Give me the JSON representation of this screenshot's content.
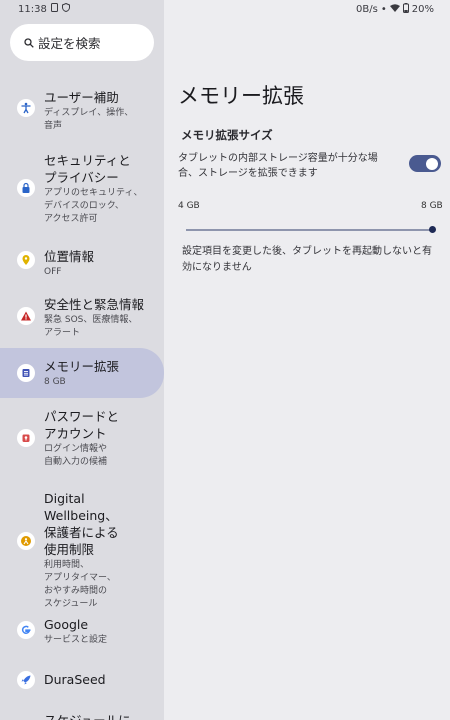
{
  "status_bar": {
    "time": "11:38",
    "network_speed": "0B/s",
    "battery": "20%"
  },
  "search": {
    "placeholder": "設定を検索"
  },
  "sidebar": {
    "items": [
      {
        "title": "ユーザー補助",
        "subtitle": "ディスプレイ、操作、\n音声",
        "icon": "accessibility-icon",
        "icon_color": "#2a64c8"
      },
      {
        "title": "セキュリティと\nプライバシー",
        "subtitle": "アプリのセキュリティ、\nデバイスのロック、\nアクセス許可",
        "icon": "lock-icon",
        "icon_color": "#2a64c8"
      },
      {
        "title": "位置情報",
        "subtitle": "OFF",
        "icon": "location-pin-icon",
        "icon_color": "#e0b300"
      },
      {
        "title": "安全性と緊急情報",
        "subtitle": "緊急 SOS、医療情報、\nアラート",
        "icon": "emergency-icon",
        "icon_color": "#c62828"
      },
      {
        "title": "メモリー拡張",
        "subtitle": "8 GB",
        "icon": "memory-icon",
        "icon_color": "#3f51b5",
        "active": true
      },
      {
        "title": "パスワードと\nアカウント",
        "subtitle": "ログイン情報や\n自動入力の候補",
        "icon": "key-icon",
        "icon_color": "#d84b4b"
      },
      {
        "title": "Digital Wellbeing、\n保護者による\n使用制限",
        "subtitle": "利用時間、\nアプリタイマー、\nおやすみ時間の\nスケジュール",
        "icon": "wellbeing-icon",
        "icon_color": "#e09a00"
      },
      {
        "title": "Google",
        "subtitle": "サービスと設定",
        "icon": "google-icon",
        "icon_color": "#4285f4"
      },
      {
        "title": "DuraSeed",
        "subtitle": "",
        "icon": "rocket-icon",
        "icon_color": "#3a6fe0"
      },
      {
        "title": "スケジュールに",
        "subtitle": "",
        "icon": "schedule-icon",
        "icon_color": "#555"
      }
    ]
  },
  "main": {
    "title": "メモリー拡張",
    "section_title": "メモリ拡張サイズ",
    "toggle_description": "タブレットの内部ストレージ容量が十分な場合、ストレージを拡張できます",
    "toggle_on": true,
    "slider": {
      "min_label": "4 GB",
      "max_label": "8 GB",
      "value_gb": 8,
      "min_gb": 4,
      "max_gb": 8
    },
    "note": "設定項目を変更した後、タブレットを再起動しないと有効になりません"
  },
  "colors": {
    "accent": "#4a5a90",
    "active_item_bg": "#c2c5dd",
    "sidebar_bg": "#dcdce1",
    "content_bg": "#ededf0"
  }
}
